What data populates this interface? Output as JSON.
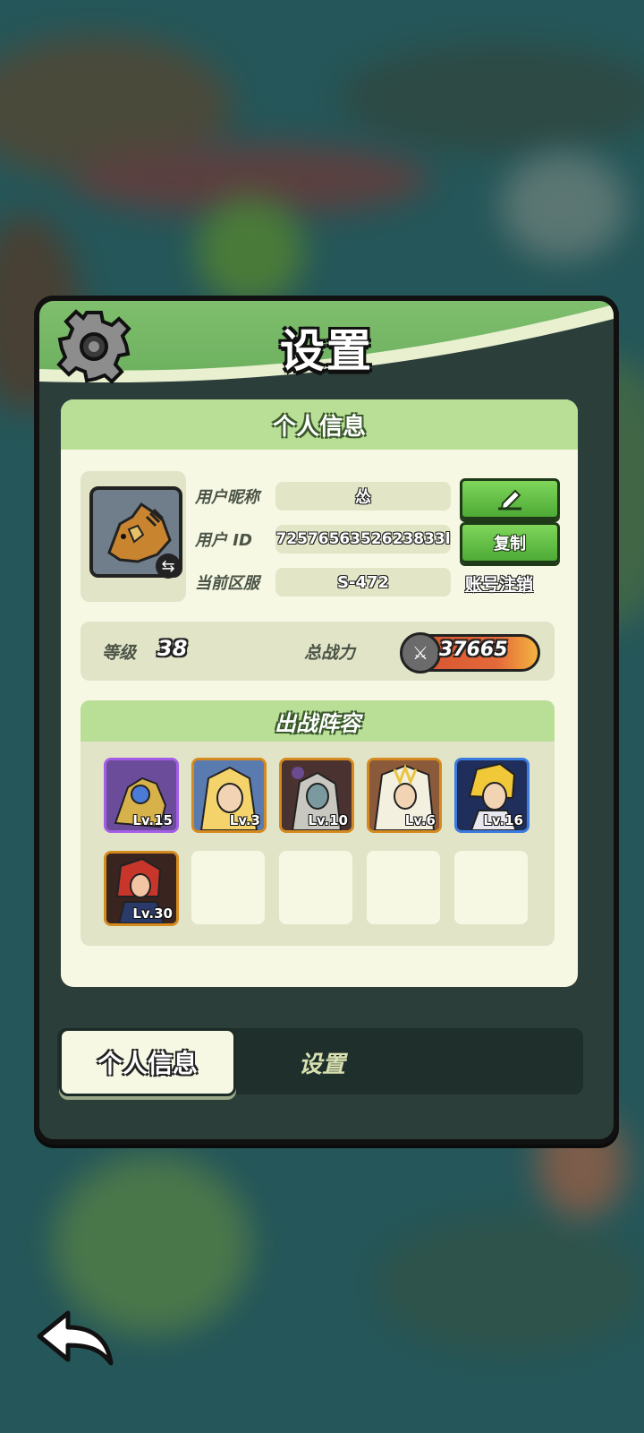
{
  "dialog": {
    "title": "设置"
  },
  "personal": {
    "section_title": "个人信息",
    "nickname_label": "用户昵称",
    "nickname_value": "怂",
    "id_label": "用户 ID",
    "id_value": "7257656352623833l",
    "server_label": "当前区服",
    "server_value": "S-472",
    "copy_button": "复制",
    "cancel_account_link": "账号注销"
  },
  "stats": {
    "level_label": "等级",
    "level_value": "38",
    "power_label": "总战力",
    "power_value": "37665"
  },
  "lineup": {
    "title": "出战阵容",
    "heroes": [
      {
        "level": "Lv.15",
        "rarity": "purple"
      },
      {
        "level": "Lv.3",
        "rarity": "orange"
      },
      {
        "level": "Lv.10",
        "rarity": "orange"
      },
      {
        "level": "Lv.6",
        "rarity": "orange"
      },
      {
        "level": "Lv.16",
        "rarity": "blue"
      },
      {
        "level": "Lv.30",
        "rarity": "orange"
      }
    ],
    "empty_slots": 4
  },
  "tabs": {
    "active": "个人信息",
    "inactive": "设置"
  },
  "icons": {
    "settings": "gear-icon",
    "edit": "pencil-icon",
    "swap": "swap-arrows-icon",
    "power": "crossed-swords-icon",
    "back": "back-arrow-icon"
  }
}
